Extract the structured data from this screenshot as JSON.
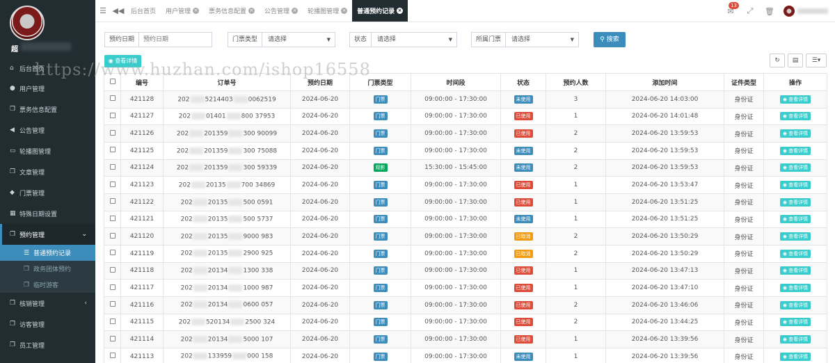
{
  "watermark": "https://www.huzhan.com/ishop16558",
  "sidebar": {
    "brand": "超",
    "items": [
      {
        "label": "后台首页",
        "icon": "home-icon"
      },
      {
        "label": "用户管理",
        "icon": "user-icon"
      },
      {
        "label": "票务信息配置",
        "icon": "copy-icon"
      },
      {
        "label": "公告管理",
        "icon": "bullhorn-icon"
      },
      {
        "label": "轮播图管理",
        "icon": "desktop-icon"
      },
      {
        "label": "文章管理",
        "icon": "copy-icon"
      },
      {
        "label": "门票管理",
        "icon": "tag-icon"
      },
      {
        "label": "特殊日期设置",
        "icon": "calendar-icon"
      },
      {
        "label": "预约管理",
        "icon": "copy-icon"
      }
    ],
    "sub_items": [
      {
        "label": "普通预约记录",
        "icon": "list-icon"
      },
      {
        "label": "政务团体预约",
        "icon": "copy-icon"
      },
      {
        "label": "临时游客",
        "icon": "copy-icon"
      }
    ],
    "bottom_items": [
      {
        "label": "核销管理",
        "icon": "copy-icon"
      },
      {
        "label": "访客管理",
        "icon": "copy-icon"
      },
      {
        "label": "员工管理",
        "icon": "copy-icon"
      }
    ]
  },
  "topbar": {
    "tabs": [
      "后台首页",
      "用户管理",
      "票务信息配置",
      "公告管理",
      "轮播图管理",
      "普通预约记录"
    ],
    "notification_count": "13"
  },
  "filters": {
    "date_label": "预约日期",
    "date_placeholder": "预约日期",
    "ticket_type_label": "门票类型",
    "ticket_type_value": "请选择",
    "status_label": "状态",
    "status_value": "请选择",
    "ticket_label": "所属门票",
    "ticket_value": "请选择",
    "search_label": "搜索"
  },
  "detail_top_label": "查看详情",
  "table": {
    "headers": [
      "编号",
      "订单号",
      "预约日期",
      "门票类型",
      "时间段",
      "状态",
      "预约人数",
      "添加时间",
      "证件类型",
      "操作"
    ],
    "action_label": "查看详情",
    "rows": [
      {
        "id": "421128",
        "order_a": "202",
        "order_b": "5214403",
        "order_c": "0062519",
        "date": "2024-06-20",
        "type": "门票",
        "type_color": "blue",
        "time": "09:00:00 - 17:30:00",
        "status": "未使用",
        "status_kind": "unused",
        "count": "3",
        "added": "2024-06-20 14:03:00",
        "cert": "身份证"
      },
      {
        "id": "421127",
        "order_a": "202",
        "order_b": "01401",
        "order_c": "800 37953",
        "date": "2024-06-20",
        "type": "门票",
        "type_color": "blue",
        "time": "09:00:00 - 17:30:00",
        "status": "已使用",
        "status_kind": "used",
        "count": "1",
        "added": "2024-06-20 14:01:48",
        "cert": "身份证"
      },
      {
        "id": "421126",
        "order_a": "202",
        "order_b": "201359",
        "order_c": "300 90099",
        "date": "2024-06-20",
        "type": "门票",
        "type_color": "blue",
        "time": "09:00:00 - 17:30:00",
        "status": "已使用",
        "status_kind": "used",
        "count": "2",
        "added": "2024-06-20 13:59:53",
        "cert": "身份证"
      },
      {
        "id": "421125",
        "order_a": "202",
        "order_b": "201359",
        "order_c": "300 75088",
        "date": "2024-06-20",
        "type": "门票",
        "type_color": "blue",
        "time": "09:00:00 - 17:30:00",
        "status": "未使用",
        "status_kind": "unused",
        "count": "2",
        "added": "2024-06-20 13:59:53",
        "cert": "身份证"
      },
      {
        "id": "421124",
        "order_a": "202",
        "order_b": "201359",
        "order_c": "300 59339",
        "date": "2024-06-20",
        "type": "观影",
        "type_color": "green",
        "time": "15:30:00 - 15:45:00",
        "status": "未使用",
        "status_kind": "unused",
        "count": "2",
        "added": "2024-06-20 13:59:53",
        "cert": "身份证"
      },
      {
        "id": "421123",
        "order_a": "202",
        "order_b": "20135",
        "order_c": "700 34869",
        "date": "2024-06-20",
        "type": "门票",
        "type_color": "blue",
        "time": "09:00:00 - 17:30:00",
        "status": "已使用",
        "status_kind": "used",
        "count": "1",
        "added": "2024-06-20 13:53:47",
        "cert": "身份证"
      },
      {
        "id": "421122",
        "order_a": "202",
        "order_b": "20135",
        "order_c": "500 0591",
        "date": "2024-06-20",
        "type": "门票",
        "type_color": "blue",
        "time": "09:00:00 - 17:30:00",
        "status": "已使用",
        "status_kind": "used",
        "count": "1",
        "added": "2024-06-20 13:51:25",
        "cert": "身份证"
      },
      {
        "id": "421121",
        "order_a": "202",
        "order_b": "20135",
        "order_c": "500 5737",
        "date": "2024-06-20",
        "type": "门票",
        "type_color": "blue",
        "time": "09:00:00 - 17:30:00",
        "status": "未使用",
        "status_kind": "unused",
        "count": "1",
        "added": "2024-06-20 13:51:25",
        "cert": "身份证"
      },
      {
        "id": "421120",
        "order_a": "202",
        "order_b": "20135",
        "order_c": "9000 983",
        "date": "2024-06-20",
        "type": "门票",
        "type_color": "blue",
        "time": "09:00:00 - 17:30:00",
        "status": "已取消",
        "status_kind": "cancel",
        "count": "2",
        "added": "2024-06-20 13:50:29",
        "cert": "身份证"
      },
      {
        "id": "421119",
        "order_a": "202",
        "order_b": "20135",
        "order_c": "2900 925",
        "date": "2024-06-20",
        "type": "门票",
        "type_color": "blue",
        "time": "09:00:00 - 17:30:00",
        "status": "已取消",
        "status_kind": "cancel",
        "count": "2",
        "added": "2024-06-20 13:50:29",
        "cert": "身份证"
      },
      {
        "id": "421118",
        "order_a": "202",
        "order_b": "20134",
        "order_c": "1300 338",
        "date": "2024-06-20",
        "type": "门票",
        "type_color": "blue",
        "time": "09:00:00 - 17:30:00",
        "status": "已使用",
        "status_kind": "used",
        "count": "1",
        "added": "2024-06-20 13:47:13",
        "cert": "身份证"
      },
      {
        "id": "421117",
        "order_a": "202",
        "order_b": "20134",
        "order_c": "1000 987",
        "date": "2024-06-20",
        "type": "门票",
        "type_color": "blue",
        "time": "09:00:00 - 17:30:00",
        "status": "已使用",
        "status_kind": "used",
        "count": "1",
        "added": "2024-06-20 13:47:10",
        "cert": "身份证"
      },
      {
        "id": "421116",
        "order_a": "202",
        "order_b": "20134",
        "order_c": "0600 057",
        "date": "2024-06-20",
        "type": "门票",
        "type_color": "blue",
        "time": "09:00:00 - 17:30:00",
        "status": "已使用",
        "status_kind": "used",
        "count": "2",
        "added": "2024-06-20 13:46:06",
        "cert": "身份证"
      },
      {
        "id": "421115",
        "order_a": "202",
        "order_b": "520134",
        "order_c": "2500 324",
        "date": "2024-06-20",
        "type": "门票",
        "type_color": "blue",
        "time": "09:00:00 - 17:30:00",
        "status": "已使用",
        "status_kind": "used",
        "count": "2",
        "added": "2024-06-20 13:44:25",
        "cert": "身份证"
      },
      {
        "id": "421114",
        "order_a": "202",
        "order_b": "20134",
        "order_c": "5000 107",
        "date": "2024-06-20",
        "type": "门票",
        "type_color": "blue",
        "time": "09:00:00 - 17:30:00",
        "status": "已使用",
        "status_kind": "used",
        "count": "1",
        "added": "2024-06-20 13:39:56",
        "cert": "身份证"
      },
      {
        "id": "421113",
        "order_a": "202",
        "order_b": "133959",
        "order_c": "000 158",
        "date": "2024-06-20",
        "type": "门票",
        "type_color": "blue",
        "time": "09:00:00 - 17:30:00",
        "status": "未使用",
        "status_kind": "unused",
        "count": "1",
        "added": "2024-06-20 13:39:56",
        "cert": "身份证"
      }
    ]
  }
}
